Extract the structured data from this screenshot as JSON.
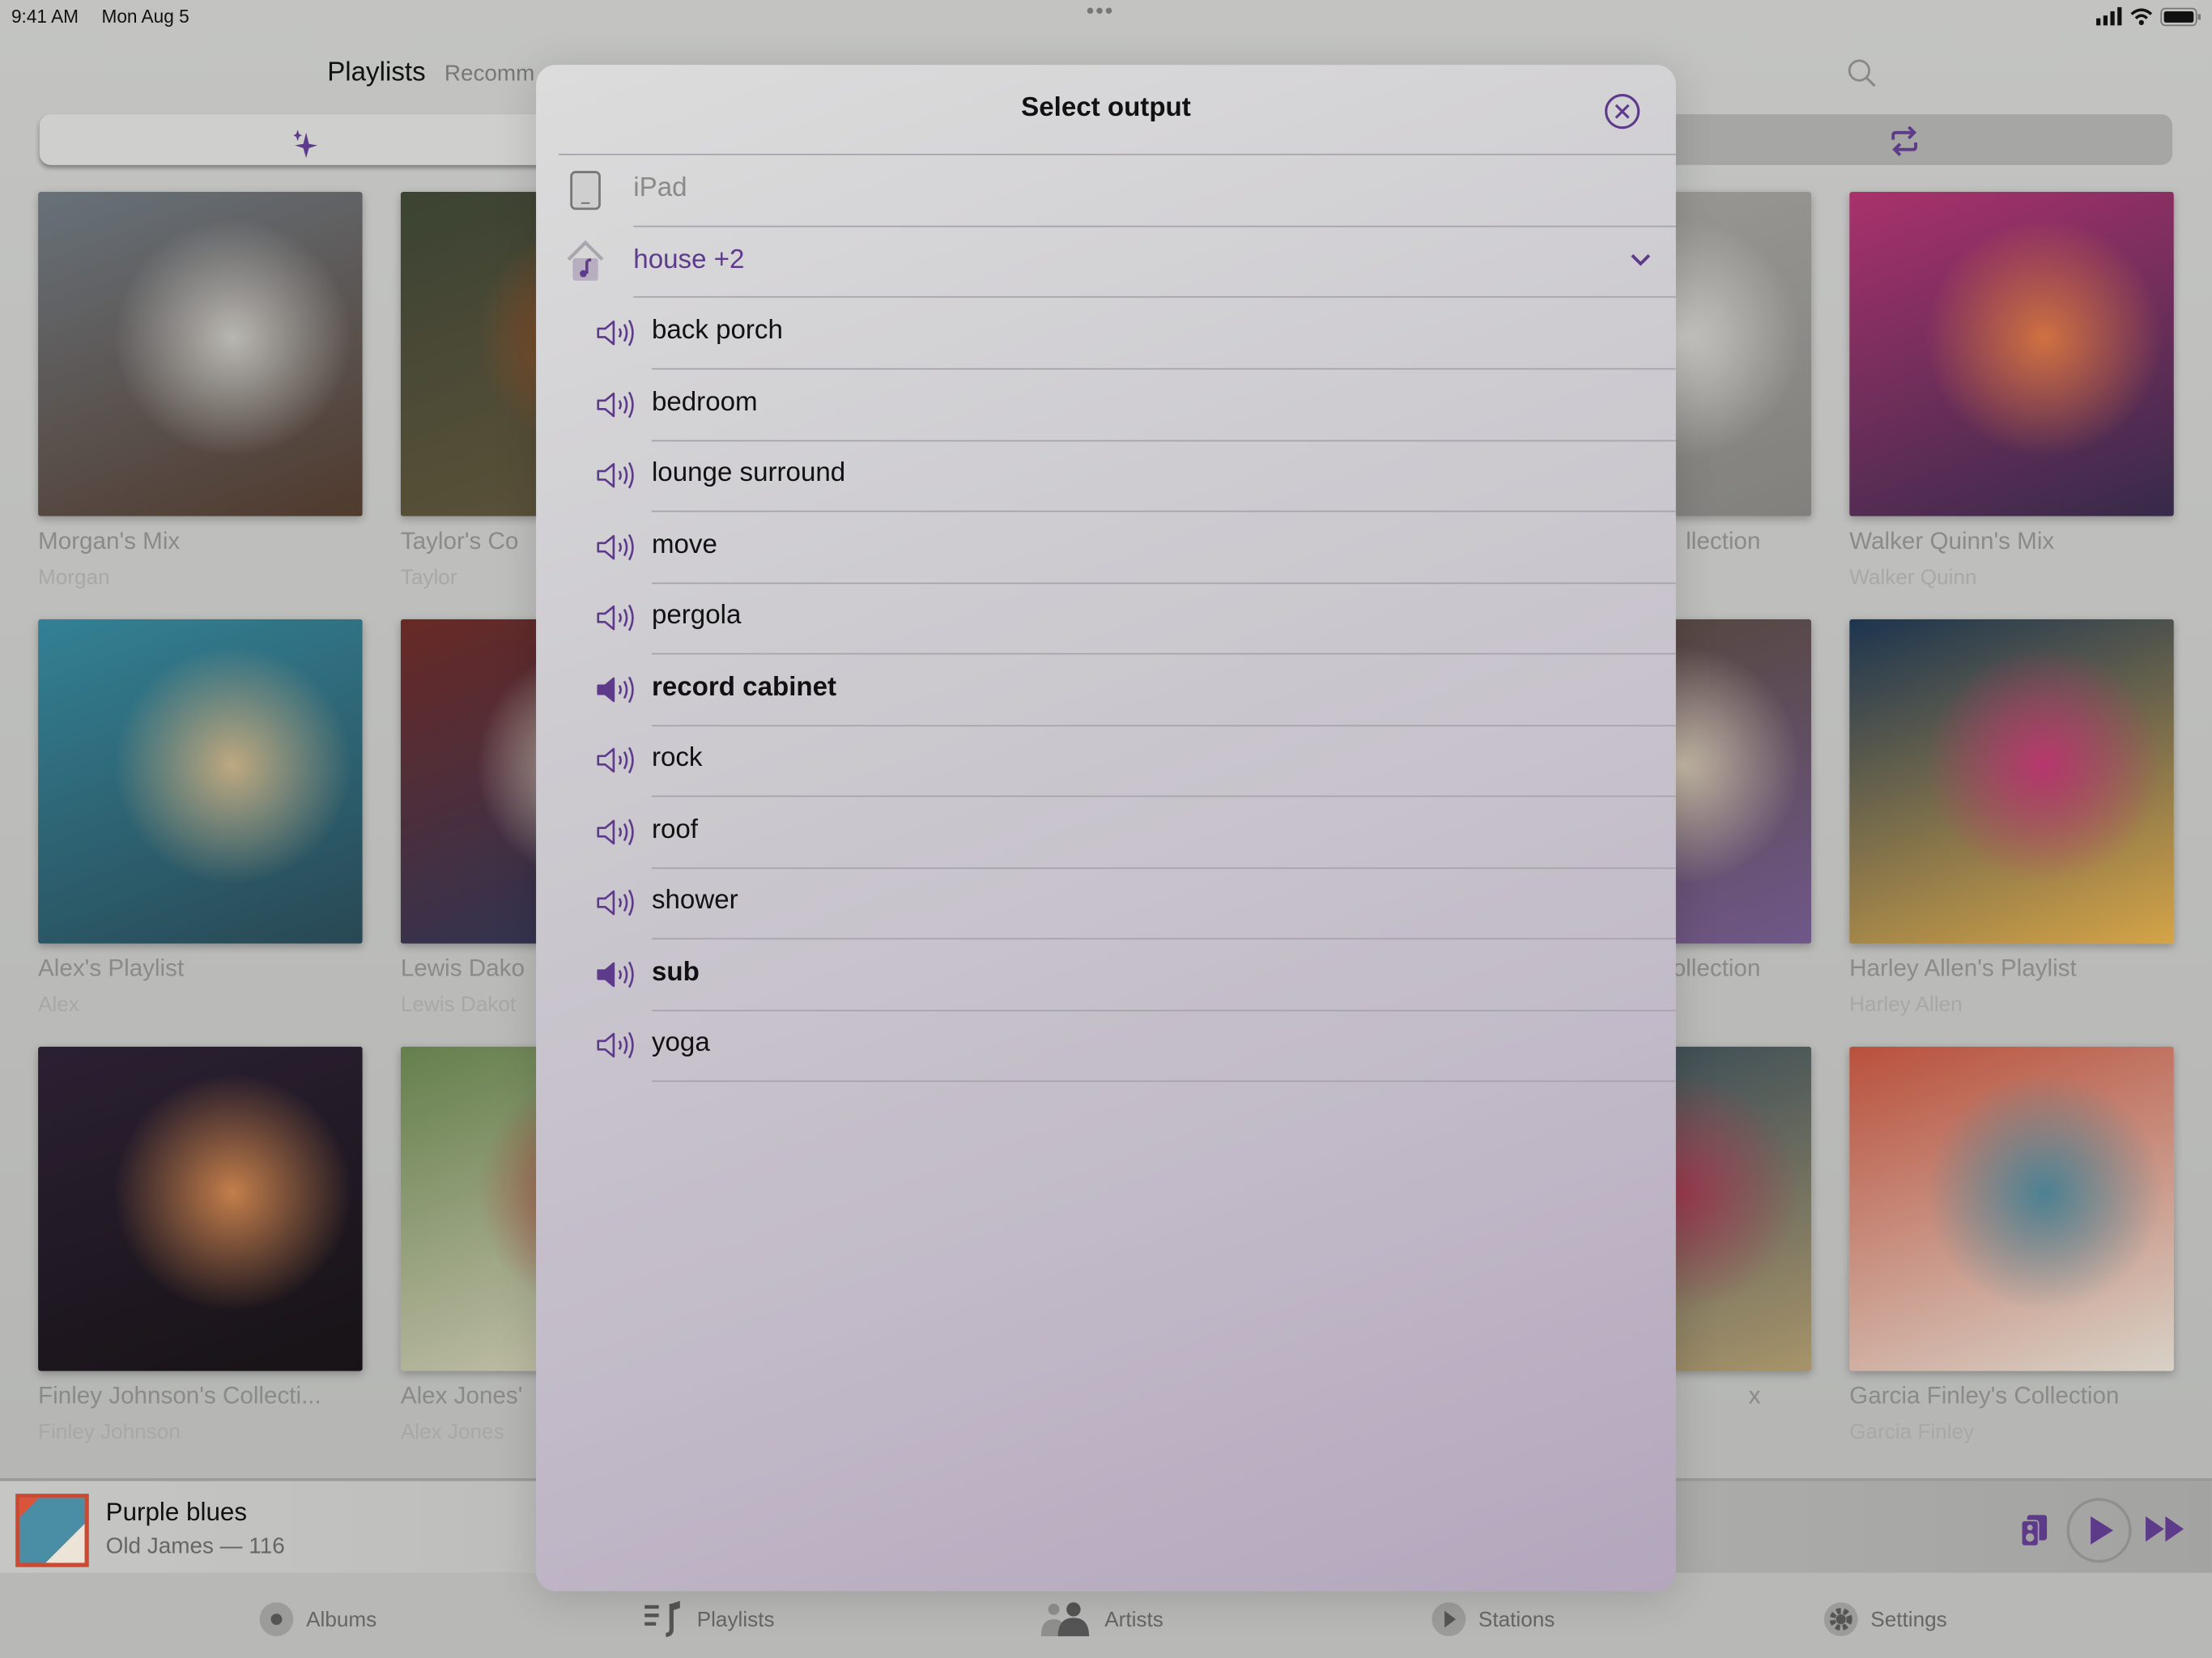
{
  "status_bar": {
    "time": "9:41 AM",
    "date": "Mon Aug 5",
    "dots": "•••"
  },
  "header": {
    "tabs": [
      {
        "label": "Playlists",
        "active": true
      },
      {
        "label": "Recomm"
      }
    ],
    "search_icon": "search-icon",
    "left_button_icon": "sparkles-icon",
    "right_button_icon": "repeat-icon"
  },
  "playlists": [
    {
      "title": "Morgan's Mix",
      "subtitle": "Morgan",
      "colors": [
        "#6f7c86",
        "#c9c7c0",
        "#5a3e2e"
      ]
    },
    {
      "title": "Taylor's Co",
      "subtitle": "Taylor",
      "colors": [
        "#3f4a34",
        "#b4511c",
        "#6a5a3a"
      ]
    },
    {
      "title": "llection",
      "subtitle": "",
      "colors": [
        "#a9a8a3",
        "#d9d8d2",
        "#8d8b86"
      ]
    },
    {
      "title": "Walker Quinn's Mix",
      "subtitle": "Walker Quinn",
      "colors": [
        "#c9307b",
        "#f0783a",
        "#3c2d55"
      ]
    },
    {
      "title": "Alex's Playlist",
      "subtitle": "Alex",
      "colors": [
        "#2b8fa8",
        "#d3b783",
        "#274f5e"
      ]
    },
    {
      "title": "Lewis Dako",
      "subtitle": "Lewis Dakot",
      "colors": [
        "#7b2a25",
        "#e7d8c3",
        "#2a3a66"
      ]
    },
    {
      "title": "Collection",
      "subtitle": "",
      "colors": [
        "#5b4a35",
        "#d6c8ae",
        "#7c5d9d"
      ]
    },
    {
      "title": "Harley Allen's Playlist",
      "subtitle": "Harley Allen",
      "colors": [
        "#1b3a5c",
        "#d9357b",
        "#f0b13a"
      ]
    },
    {
      "title": "Finley Johnson's Collecti...",
      "subtitle": "Finley Johnson",
      "colors": [
        "#30223a",
        "#e08745",
        "#1a1418"
      ]
    },
    {
      "title": "Alex Jones'",
      "subtitle": "Alex Jones",
      "colors": [
        "#6a8c4a",
        "#c24a3a",
        "#e0d8c0"
      ]
    },
    {
      "title": "x",
      "subtitle": "",
      "colors": [
        "#2e4a5e",
        "#b43a55",
        "#b9a06a"
      ]
    },
    {
      "title": "Garcia Finley's Collection",
      "subtitle": "Garcia Finley",
      "colors": [
        "#d9543a",
        "#4a8ea5",
        "#ece4d6"
      ]
    }
  ],
  "modal": {
    "title": "Select output",
    "close_icon": "close-circle-icon",
    "device": {
      "label": "iPad",
      "icon": "ipad-icon"
    },
    "group": {
      "label": "house +2",
      "icon": "home-music-icon",
      "expanded": true
    },
    "speakers": [
      {
        "label": "back porch",
        "selected": false
      },
      {
        "label": "bedroom",
        "selected": false
      },
      {
        "label": "lounge surround",
        "selected": false
      },
      {
        "label": "move",
        "selected": false
      },
      {
        "label": "pergola",
        "selected": false
      },
      {
        "label": "record cabinet",
        "selected": true
      },
      {
        "label": "rock",
        "selected": false
      },
      {
        "label": "roof",
        "selected": false
      },
      {
        "label": "shower",
        "selected": false
      },
      {
        "label": "sub",
        "selected": true
      },
      {
        "label": "yoga",
        "selected": false
      }
    ]
  },
  "now_playing": {
    "title": "Purple blues",
    "subtitle": "Old James — 116",
    "is_playing": false
  },
  "tab_bar": [
    {
      "label": "Albums",
      "icon": "record-icon"
    },
    {
      "label": "Playlists",
      "icon": "playlist-icon",
      "active": true
    },
    {
      "label": "Artists",
      "icon": "people-icon"
    },
    {
      "label": "Stations",
      "icon": "play-circle-icon"
    },
    {
      "label": "Settings",
      "icon": "gear-icon"
    }
  ],
  "colors": {
    "accent": "#5e3a8a",
    "text": "#111111",
    "muted": "#8a8a88"
  }
}
